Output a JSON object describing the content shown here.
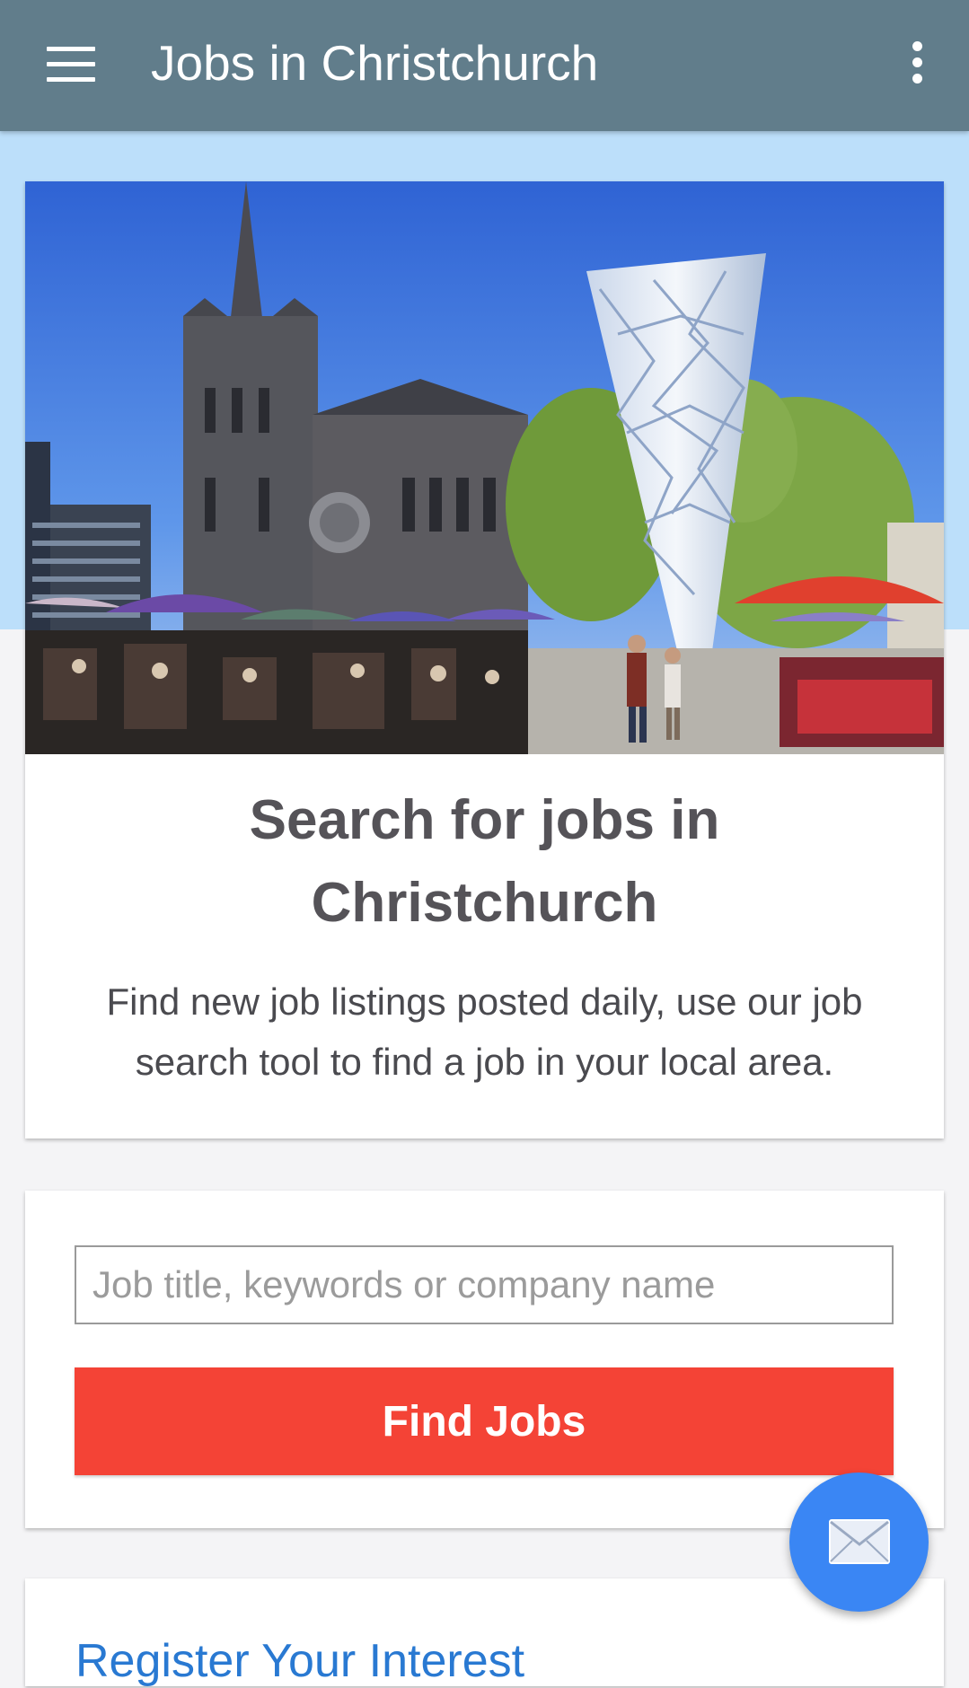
{
  "app_bar": {
    "title": "Jobs in Christchurch",
    "icons": [
      "menu-icon",
      "more-vert-icon"
    ]
  },
  "hero": {
    "title": "Search for jobs in Christchurch",
    "description": "Find new job listings posted daily, use our job search tool to find a job in your local area."
  },
  "search": {
    "placeholder": "Job title, keywords or company name",
    "value": "",
    "button_label": "Find Jobs"
  },
  "register": {
    "label": "Register Your Interest"
  },
  "fab": {
    "icon": "email-icon"
  },
  "colors": {
    "app_bar": "#617d8b",
    "hero_band": "#bcdffa",
    "find_button": "#f44336",
    "fab": "#3a86f4",
    "link": "#2979d2"
  }
}
